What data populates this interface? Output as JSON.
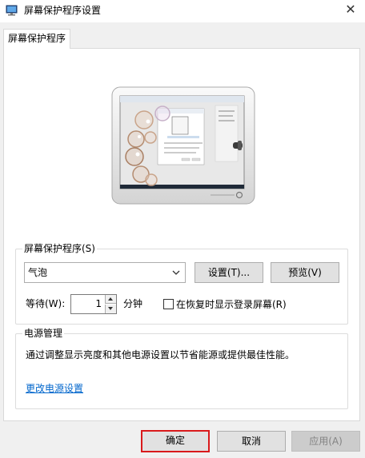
{
  "window": {
    "title": "屏幕保护程序设置",
    "close_glyph": "✕"
  },
  "tab": {
    "label": "屏幕保护程序"
  },
  "screensaver": {
    "group_label": "屏幕保护程序(S)",
    "selected": "气泡",
    "settings_button": "设置(T)...",
    "preview_button": "预览(V)",
    "wait_label": "等待(W):",
    "wait_value": "1",
    "wait_unit": "分钟",
    "resume_checkbox_label": "在恢复时显示登录屏幕(R)",
    "resume_checked": false
  },
  "power": {
    "group_label": "电源管理",
    "description": "通过调整显示亮度和其他电源设置以节省能源或提供最佳性能。",
    "link": "更改电源设置"
  },
  "footer": {
    "ok": "确定",
    "cancel": "取消",
    "apply": "应用(A)"
  },
  "colors": {
    "link": "#0066cc",
    "focus_outline": "#d9191b",
    "dialog_bg": "#f0f0f0"
  },
  "icons": {
    "title": "screensaver-app-icon",
    "close": "close-icon",
    "dropdown": "chevron-down-icon"
  }
}
